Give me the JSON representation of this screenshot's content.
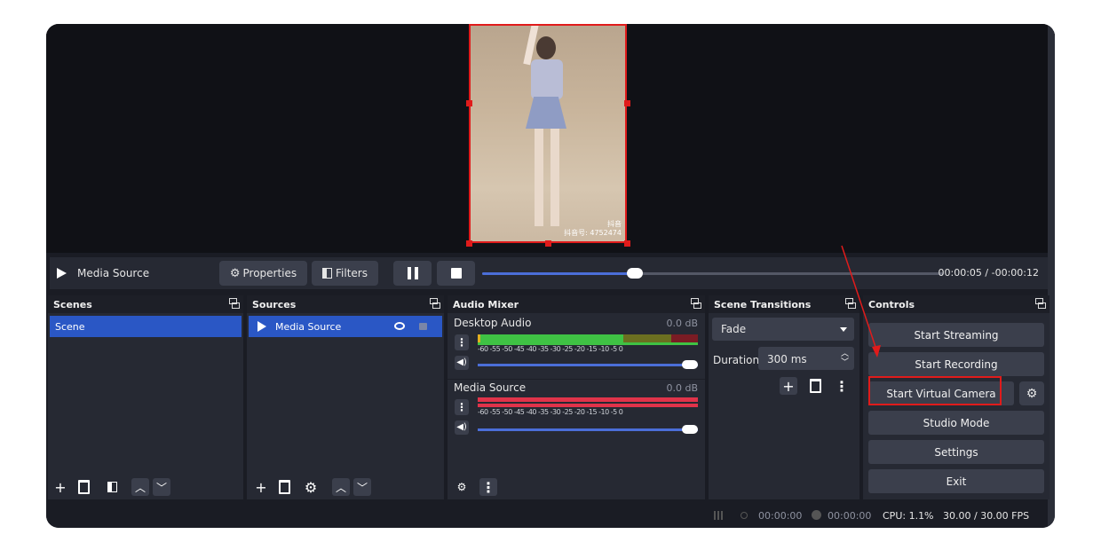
{
  "media_bar": {
    "source_name": "Media Source",
    "properties_label": "Properties",
    "filters_label": "Filters",
    "time_text": "00:00:05  /  -00:00:12",
    "seek_progress": 0.33
  },
  "video": {
    "watermark_app": "抖音",
    "watermark_id": "抖音号: 4752474"
  },
  "scenes": {
    "title": "Scenes",
    "items": [
      "Scene"
    ]
  },
  "sources": {
    "title": "Sources",
    "items": [
      "Media Source"
    ]
  },
  "audio_mixer": {
    "title": "Audio Mixer",
    "channels": [
      {
        "name": "Desktop Audio",
        "db": "0.0 dB",
        "volume": 1.0
      },
      {
        "name": "Media Source",
        "db": "0.0 dB",
        "volume": 1.0
      }
    ],
    "ticks": "-60  -55  -50  -45  -40  -35  -30  -25  -20  -15  -10  -5   0"
  },
  "transitions": {
    "title": "Scene Transitions",
    "selected": "Fade",
    "duration_label": "Duration",
    "duration_value": "300 ms"
  },
  "controls": {
    "title": "Controls",
    "start_streaming": "Start Streaming",
    "start_recording": "Start Recording",
    "start_virtual_camera": "Start Virtual Camera",
    "studio_mode": "Studio Mode",
    "settings": "Settings",
    "exit": "Exit"
  },
  "status_bar": {
    "rec_time": "00:00:00",
    "stream_time": "00:00:00",
    "cpu": "CPU: 1.1%",
    "fps": "30.00 / 30.00 FPS"
  },
  "colors": {
    "accent": "#2a57c5",
    "annotation": "#e01b1b",
    "meter_green": "#3fc244",
    "meter_red": "#e0334a"
  },
  "icons": [
    "play-icon",
    "gear-icon",
    "filter-icon",
    "pause-icon",
    "stop-icon",
    "eye-icon",
    "lock-icon",
    "plus-icon",
    "trash-icon",
    "up-icon",
    "down-icon",
    "speaker-icon",
    "kebab-icon"
  ]
}
